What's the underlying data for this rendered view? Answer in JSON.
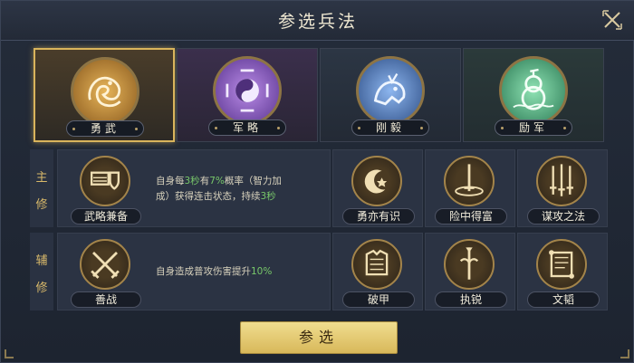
{
  "header": {
    "title": "参选兵法",
    "close_icon": "close-icon"
  },
  "categories": [
    {
      "label": "勇武",
      "icon": "dragon-emblem-icon",
      "color": "#d9a24a",
      "selected": true
    },
    {
      "label": "军略",
      "icon": "bagua-emblem-icon",
      "color": "#9c6fd0",
      "selected": false
    },
    {
      "label": "刚毅",
      "icon": "beast-emblem-icon",
      "color": "#7aa6e0",
      "selected": false
    },
    {
      "label": "励军",
      "icon": "gourd-emblem-icon",
      "color": "#6fcf9a",
      "selected": false
    }
  ],
  "main": {
    "label_1": "主",
    "label_2": "修",
    "primary": {
      "name": "武略兼备",
      "icon": "scroll-shield-icon",
      "desc_a": "自身每",
      "desc_b": "3秒",
      "desc_c": "有",
      "desc_d": "7%",
      "desc_e": "概率（智力加",
      "desc_f": "成）获得连击状态，持续",
      "desc_g": "3秒"
    },
    "options": [
      {
        "name": "勇亦有识",
        "icon": "crescent-star-icon"
      },
      {
        "name": "险中得富",
        "icon": "sword-ring-icon"
      },
      {
        "name": "谋攻之法",
        "icon": "triple-swords-icon"
      }
    ]
  },
  "aux": {
    "label_1": "辅",
    "label_2": "修",
    "primary": {
      "name": "善战",
      "icon": "crossed-swords-icon",
      "desc_a": "自身造成普攻伤害提升",
      "desc_b": "10%"
    },
    "options": [
      {
        "name": "破甲",
        "icon": "armor-icon"
      },
      {
        "name": "执锐",
        "icon": "spear-icon"
      },
      {
        "name": "文韬",
        "icon": "scroll-icon"
      }
    ]
  },
  "confirm_button": {
    "label": "参选"
  },
  "colors": {
    "gold": "#d9b45c",
    "highlight": "#78c86a"
  }
}
